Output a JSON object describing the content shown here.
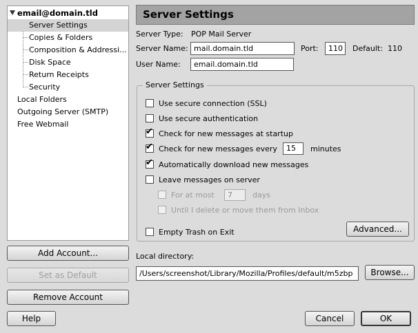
{
  "account_tree": {
    "account": "email@domain.tld",
    "children": [
      "Server Settings",
      "Copies & Folders",
      "Composition & Addressi...",
      "Disk Space",
      "Return Receipts",
      "Security"
    ],
    "others": [
      "Local Folders",
      "Outgoing Server (SMTP)",
      "Free Webmail"
    ],
    "selected": "Server Settings"
  },
  "left_buttons": {
    "add": "Add Account...",
    "set_default": "Set as Default",
    "remove": "Remove Account"
  },
  "header": {
    "title": "Server Settings"
  },
  "server": {
    "type_label": "Server Type:",
    "type_value": "POP Mail Server",
    "name_label": "Server Name:",
    "name_value": "mail.domain.tld",
    "port_label": "Port:",
    "port_value": "110",
    "default_label": "Default:",
    "default_value": "110",
    "user_label": "User Name:",
    "user_value": "email.domain.tld"
  },
  "group": {
    "legend": "Server Settings",
    "ssl": {
      "label": "Use secure connection (SSL)",
      "checked": false
    },
    "secure_auth": {
      "label": "Use secure authentication",
      "checked": false
    },
    "check_startup": {
      "label": "Check for new messages at startup",
      "checked": true
    },
    "check_every": {
      "label": "Check for new messages every",
      "value": "15",
      "unit": "minutes",
      "checked": true
    },
    "auto_download": {
      "label": "Automatically download new messages",
      "checked": true
    },
    "leave_on_server": {
      "label": "Leave messages on server",
      "checked": false
    },
    "for_at_most": {
      "label": "For at most",
      "value": "7",
      "unit": "days",
      "checked": false
    },
    "until_delete": {
      "label": "Until I delete or move them from Inbox",
      "checked": false
    },
    "empty_trash": {
      "label": "Empty Trash on Exit",
      "checked": false
    },
    "advanced": "Advanced..."
  },
  "local_dir": {
    "label": "Local directory:",
    "value": "/Users/screenshot/Library/Mozilla/Profiles/default/m5zbp",
    "browse": "Browse..."
  },
  "footer": {
    "help": "Help",
    "cancel": "Cancel",
    "ok": "OK"
  }
}
